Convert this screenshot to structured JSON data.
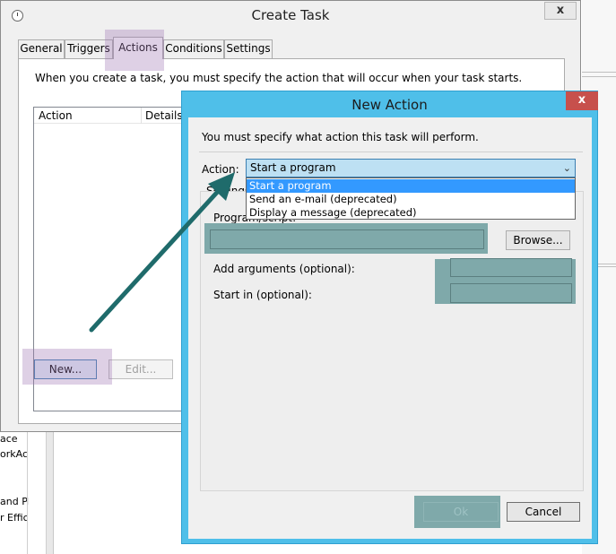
{
  "background": {
    "left_text": [
      "ace",
      "orkAc",
      "and Pl",
      "r Effic"
    ]
  },
  "create_task": {
    "title": "Create Task",
    "close_label": "x",
    "tabs": [
      {
        "label": "General"
      },
      {
        "label": "Triggers"
      },
      {
        "label": "Actions"
      },
      {
        "label": "Conditions"
      },
      {
        "label": "Settings"
      }
    ],
    "active_tab": "Actions",
    "description": "When you create a task, you must specify the action that will occur when your task starts.",
    "list_columns": [
      "Action",
      "Details"
    ],
    "buttons": {
      "new": "New...",
      "edit": "Edit..."
    }
  },
  "new_action": {
    "title": "New Action",
    "close_label": "x",
    "description": "You must specify what action this task will perform.",
    "action_label": "Action:",
    "action_value": "Start a program",
    "action_options": [
      "Start a program",
      "Send an e-mail (deprecated)",
      "Display a message (deprecated)"
    ],
    "settings_label": "Settings",
    "program_label": "Program/script:",
    "program_value": "",
    "browse_label": "Browse...",
    "args_label": "Add arguments (optional):",
    "start_label": "Start in (optional):",
    "ok_label": "Ok",
    "cancel_label": "Cancel"
  },
  "colors": {
    "dialog_frame": "#4fbfe9",
    "highlight_purple": "#a078b4",
    "annotation_teal": "#1f6b6b",
    "redacted_field": "#7fa9aa",
    "dropdown_selected": "#3399ff"
  }
}
